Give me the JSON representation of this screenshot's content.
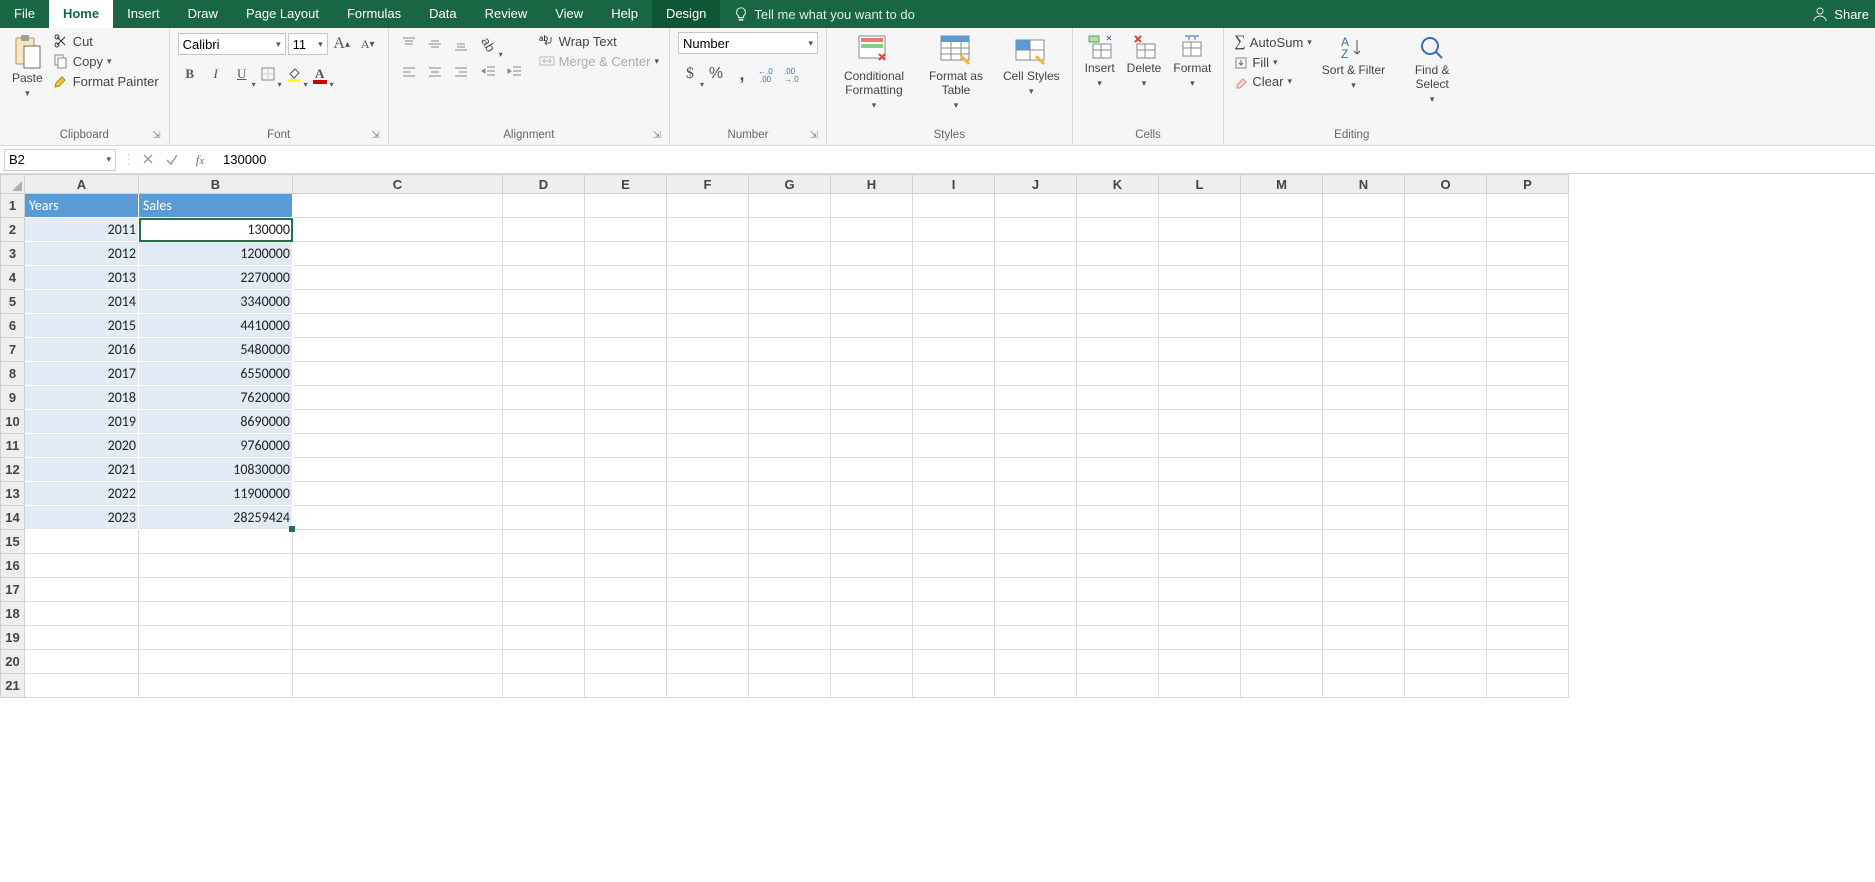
{
  "tabs": {
    "file": "File",
    "home": "Home",
    "insert": "Insert",
    "draw": "Draw",
    "page_layout": "Page Layout",
    "formulas": "Formulas",
    "data": "Data",
    "review": "Review",
    "view": "View",
    "help": "Help",
    "design": "Design",
    "tell_me": "Tell me what you want to do",
    "share": "Share"
  },
  "ribbon": {
    "paste": "Paste",
    "cut": "Cut",
    "copy": "Copy",
    "format_painter": "Format Painter",
    "clipboard": "Clipboard",
    "font_name": "Calibri",
    "font_size": "11",
    "font": "Font",
    "wrap_text": "Wrap Text",
    "merge_center": "Merge & Center",
    "alignment": "Alignment",
    "number_format": "Number",
    "number": "Number",
    "cond_fmt": "Conditional Formatting",
    "fmt_table": "Format as Table",
    "cell_styles": "Cell Styles",
    "styles": "Styles",
    "insert": "Insert",
    "delete": "Delete",
    "format": "Format",
    "cells": "Cells",
    "autosum": "AutoSum",
    "fill": "Fill",
    "clear": "Clear",
    "sort_filter": "Sort & Filter",
    "find_select": "Find & Select",
    "editing": "Editing"
  },
  "formula_bar": {
    "name": "B2",
    "formula": "130000"
  },
  "grid": {
    "cols": [
      "A",
      "B",
      "C",
      "D",
      "E",
      "F",
      "G",
      "H",
      "I",
      "J",
      "K",
      "L",
      "M",
      "N",
      "O",
      "P"
    ],
    "headers": {
      "a": "Years",
      "b": "Sales"
    },
    "rows": [
      {
        "r": 2,
        "a": "2011",
        "b": "130000"
      },
      {
        "r": 3,
        "a": "2012",
        "b": "1200000"
      },
      {
        "r": 4,
        "a": "2013",
        "b": "2270000"
      },
      {
        "r": 5,
        "a": "2014",
        "b": "3340000"
      },
      {
        "r": 6,
        "a": "2015",
        "b": "4410000"
      },
      {
        "r": 7,
        "a": "2016",
        "b": "5480000"
      },
      {
        "r": 8,
        "a": "2017",
        "b": "6550000"
      },
      {
        "r": 9,
        "a": "2018",
        "b": "7620000"
      },
      {
        "r": 10,
        "a": "2019",
        "b": "8690000"
      },
      {
        "r": 11,
        "a": "2020",
        "b": "9760000"
      },
      {
        "r": 12,
        "a": "2021",
        "b": "10830000"
      },
      {
        "r": 13,
        "a": "2022",
        "b": "11900000"
      },
      {
        "r": 14,
        "a": "2023",
        "b": "28259424"
      }
    ],
    "empty_rows": [
      15,
      16,
      17,
      18,
      19,
      20,
      21
    ]
  }
}
